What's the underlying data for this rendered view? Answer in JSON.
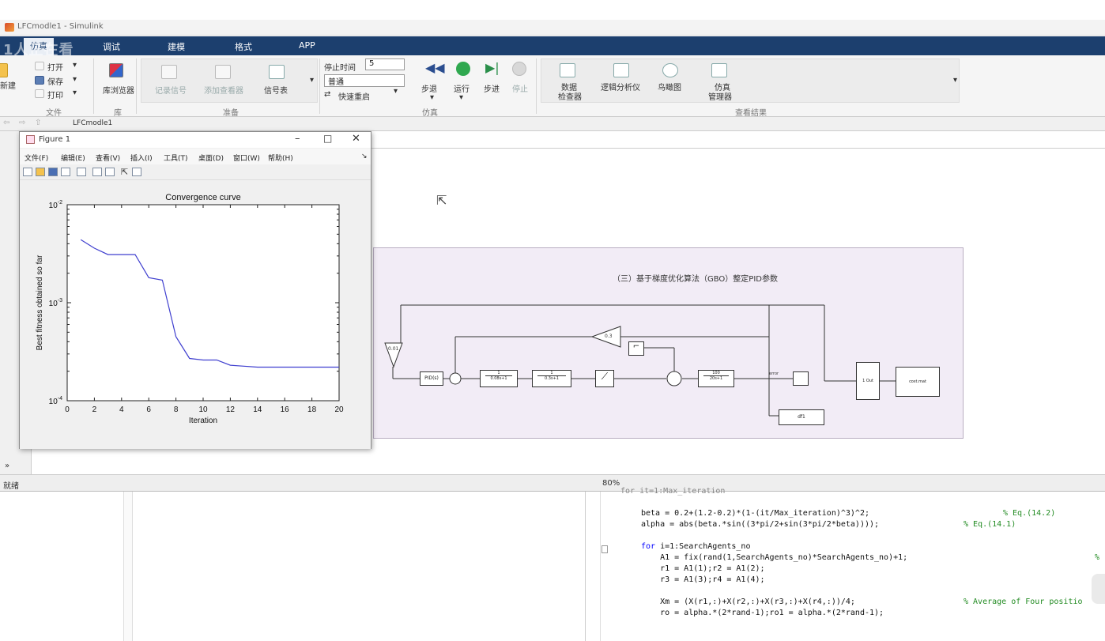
{
  "window": {
    "title": "LFCmodle1 - Simulink"
  },
  "overlay": {
    "watermark": "1人正在看"
  },
  "ribbon": {
    "tabs": [
      "仿真",
      "调试",
      "建模",
      "格式",
      "APP"
    ],
    "file": {
      "open": "打开",
      "save": "保存",
      "print": "打印",
      "new": "新建",
      "group": "文件"
    },
    "library": {
      "browser": "库浏览器",
      "group": "库"
    },
    "prepare": {
      "log_signal": "记录信号",
      "add_viewer": "添加查看器",
      "signal_table": "信号表",
      "group": "准备"
    },
    "simulate": {
      "stop_time_label": "停止时间",
      "stop_time_value": "5",
      "mode_value": "普通",
      "fast_restart": "快速重启",
      "step_back": "步退",
      "run": "运行",
      "step_forward": "步进",
      "stop": "停止",
      "group": "仿真"
    },
    "review": {
      "data_inspector_1": "数据",
      "data_inspector_2": "检查器",
      "logic_analyzer": "逻辑分析仪",
      "bird_eye": "鸟瞰图",
      "sim_manager_1": "仿真",
      "sim_manager_2": "管理器",
      "group": "查看结果"
    }
  },
  "model": {
    "tab": "LFCmodle1"
  },
  "statusbar": {
    "left": "就绪",
    "zoom": "80%"
  },
  "figure": {
    "title": "Figure 1",
    "menus": [
      "文件(F)",
      "编辑(E)",
      "查看(V)",
      "插入(I)",
      "工具(T)",
      "桌面(D)",
      "窗口(W)",
      "帮助(H)"
    ]
  },
  "chart_data": {
    "type": "line",
    "title": "Convergence curve",
    "xlabel": "Iteration",
    "ylabel": "Best fitness obtained so far",
    "xlim": [
      0,
      20
    ],
    "ylim": [
      0.0001,
      0.01
    ],
    "yscale": "log",
    "xticks": [
      "0",
      "2",
      "4",
      "6",
      "8",
      "10",
      "12",
      "14",
      "16",
      "18",
      "20"
    ],
    "yticks": [
      {
        "base": "10",
        "exp": "-2",
        "value": 0.01
      },
      {
        "base": "10",
        "exp": "-3",
        "value": 0.001
      },
      {
        "base": "10",
        "exp": "-4",
        "value": 0.0001
      }
    ],
    "grid": false,
    "color": "#3f3fcf",
    "series": [
      {
        "x": [
          1,
          2,
          3,
          4,
          5,
          6,
          7,
          8,
          9,
          10,
          11,
          12,
          13,
          14,
          15,
          16,
          17,
          18,
          19,
          20
        ],
        "values": [
          0.0044,
          0.0036,
          0.0031,
          0.0031,
          0.0031,
          0.0018,
          0.0017,
          0.00045,
          0.00027,
          0.00026,
          0.00026,
          0.00023,
          0.000225,
          0.00022,
          0.00022,
          0.00022,
          0.00022,
          0.00022,
          0.00022,
          0.00022
        ]
      }
    ]
  },
  "diagram": {
    "title": "（三）基于梯度优化算法（GBO）整定PID参数",
    "blocks": {
      "gain1": "0.01",
      "pid": "PID(s)",
      "tf1_num": "1",
      "tf1_den": "0.08s+1",
      "tf2_num": "1",
      "tf2_den": "0.3s+1",
      "gain2": "0.3",
      "tf3_num": "100",
      "tf3_den": "20s+1",
      "dff": "df1",
      "error_label": "error",
      "to_ws_right": "cost.mat",
      "mux": "1 Out"
    }
  },
  "editor": {
    "header": "for it=1:Max_iteration",
    "lines": [
      {
        "code": "beta = 0.2+(1.2-0.2)*(1-(it/Max_iteration)^3)^2;",
        "comment": "% Eq.(14.2)"
      },
      {
        "code": "alpha = abs(beta.*sin((3*pi/2+sin(3*pi/2*beta))));",
        "comment": "% Eq.(14.1)"
      },
      {
        "code": "",
        "comment": ""
      },
      {
        "kw": "for",
        "code": " i=1:SearchAgents_no",
        "comment": ""
      },
      {
        "code": "    A1 = fix(rand(1,SearchAgents_no)*SearchAgents_no)+1;",
        "comment": "%"
      },
      {
        "code": "    r1 = A1(1);r2 = A1(2);",
        "comment": ""
      },
      {
        "code": "    r3 = A1(3);r4 = A1(4);",
        "comment": ""
      },
      {
        "code": "",
        "comment": ""
      },
      {
        "code": "    Xm = (X(r1,:)+X(r2,:)+X(r3,:)+X(r4,:))/4;",
        "comment": "% Average of Four positio"
      },
      {
        "code": "    ro = alpha.*(2*rand-1);ro1 = alpha.*(2*rand-1);",
        "comment": ""
      }
    ]
  }
}
